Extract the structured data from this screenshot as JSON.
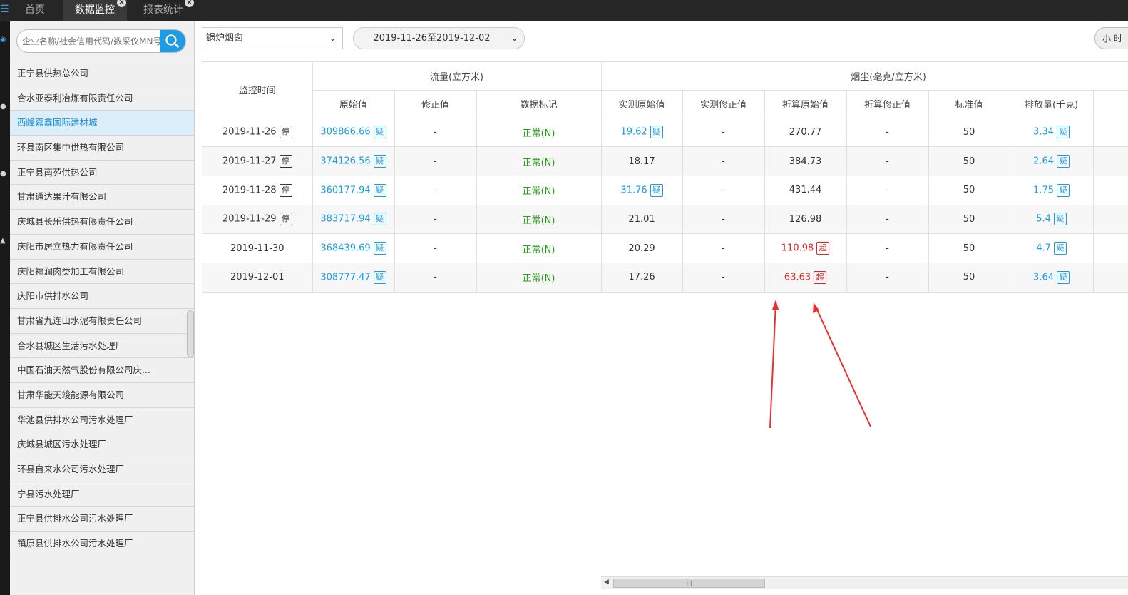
{
  "tabs": [
    {
      "label": "首页",
      "active": false
    },
    {
      "label": "数据监控",
      "active": true
    },
    {
      "label": "报表统计",
      "active": false
    }
  ],
  "search": {
    "placeholder": "企业名称/社会信用代码/数采仪MN号"
  },
  "companies": [
    "正宁县供热总公司",
    "合水亚泰利冶炼有限责任公司",
    "西峰嘉鑫国际建材城",
    "环县南区集中供热有限公司",
    "正宁县南苑供热公司",
    "甘肃通达果汁有限公司",
    "庆城县长乐供热有限责任公司",
    "庆阳市居立热力有限责任公司",
    "庆阳福润肉类加工有限公司",
    "庆阳市供排水公司",
    "甘肃省九连山水泥有限责任公司",
    "合水县城区生活污水处理厂",
    "中国石油天然气股份有限公司庆...",
    "甘肃华能天竣能源有限公司",
    "华池县供排水公司污水处理厂",
    "庆城县城区污水处理厂",
    "环县自来水公司污水处理厂",
    "宁县污水处理厂",
    "正宁县供排水公司污水处理厂",
    "镇原县供排水公司污水处理厂"
  ],
  "selected_company_index": 2,
  "toolbar": {
    "outlet": "锅炉烟囱",
    "date_range": "2019-11-26至2019-12-02",
    "hour_label": "小 时"
  },
  "table": {
    "time_header": "监控时间",
    "group_flow": "流量(立方米)",
    "group_dust": "烟尘(毫克/立方米)",
    "columns": [
      "原始值",
      "修正值",
      "数据标记",
      "实测原始值",
      "实测修正值",
      "折算原始值",
      "折算修正值",
      "标准值",
      "排放量(千克)"
    ],
    "badge_yi": "疑",
    "badge_chao": "超",
    "badge_ting": "停",
    "rows": [
      {
        "time": "2019-11-26",
        "stop": true,
        "flow": "309866.66",
        "flow_fix": "-",
        "mark": "正常(N)",
        "measured": "19.62",
        "measured_flag": true,
        "measured_fix": "-",
        "converted": "270.77",
        "converted_over": false,
        "converted_fix": "-",
        "standard": "50",
        "emission": "3.34"
      },
      {
        "time": "2019-11-27",
        "stop": true,
        "flow": "374126.56",
        "flow_fix": "-",
        "mark": "正常(N)",
        "measured": "18.17",
        "measured_flag": false,
        "measured_fix": "-",
        "converted": "384.73",
        "converted_over": false,
        "converted_fix": "-",
        "standard": "50",
        "emission": "2.64"
      },
      {
        "time": "2019-11-28",
        "stop": true,
        "flow": "360177.94",
        "flow_fix": "-",
        "mark": "正常(N)",
        "measured": "31.76",
        "measured_flag": true,
        "measured_fix": "-",
        "converted": "431.44",
        "converted_over": false,
        "converted_fix": "-",
        "standard": "50",
        "emission": "1.75"
      },
      {
        "time": "2019-11-29",
        "stop": true,
        "flow": "383717.94",
        "flow_fix": "-",
        "mark": "正常(N)",
        "measured": "21.01",
        "measured_flag": false,
        "measured_fix": "-",
        "converted": "126.98",
        "converted_over": false,
        "converted_fix": "-",
        "standard": "50",
        "emission": "5.4"
      },
      {
        "time": "2019-11-30",
        "stop": false,
        "flow": "368439.69",
        "flow_fix": "-",
        "mark": "正常(N)",
        "measured": "20.29",
        "measured_flag": false,
        "measured_fix": "-",
        "converted": "110.98",
        "converted_over": true,
        "converted_fix": "-",
        "standard": "50",
        "emission": "4.7"
      },
      {
        "time": "2019-12-01",
        "stop": false,
        "flow": "308777.47",
        "flow_fix": "-",
        "mark": "正常(N)",
        "measured": "17.26",
        "measured_flag": false,
        "measured_fix": "-",
        "converted": "63.63",
        "converted_over": true,
        "converted_fix": "-",
        "standard": "50",
        "emission": "3.64"
      }
    ]
  },
  "colors": {
    "accent": "#1e9be3",
    "normal": "#2c9c1e",
    "over": "#e02424",
    "annotation_arrow": "#e83030"
  }
}
